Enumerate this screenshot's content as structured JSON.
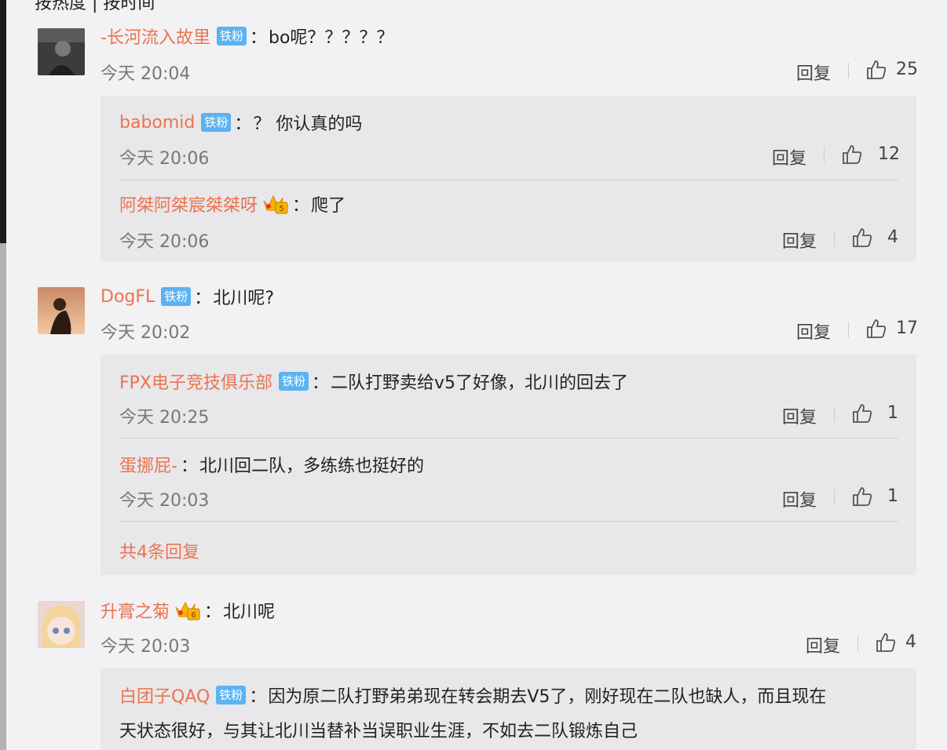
{
  "top_cut_text": "按热度 | 按时间",
  "comments": [
    {
      "user": "-长河流入故里",
      "badge": "铁粉",
      "text": "bo呢？？？？？",
      "time": "今天 20:04",
      "reply_label": "回复",
      "likes": "25",
      "replies": [
        {
          "user": "babomid",
          "badge": "铁粉",
          "text": "？ 你认真的吗",
          "time": "今天 20:06",
          "reply_label": "回复",
          "likes": "12"
        },
        {
          "user": "阿桀阿桀宸桀桀呀",
          "badge_icon": "crown-badge-icon",
          "text": "爬了",
          "time": "今天 20:06",
          "reply_label": "回复",
          "likes": "4"
        }
      ]
    },
    {
      "user": "DogFL",
      "badge": "铁粉",
      "text": "北川呢?",
      "time": "今天 20:02",
      "reply_label": "回复",
      "likes": "17",
      "replies": [
        {
          "user": "FPX电子竞技俱乐部",
          "badge": "铁粉",
          "text": "二队打野卖给v5了好像，北川的回去了",
          "time": "今天 20:25",
          "reply_label": "回复",
          "likes": "1"
        },
        {
          "user": "蛋挪屁-",
          "text": "北川回二队，多练练也挺好的",
          "time": "今天 20:03",
          "reply_label": "回复",
          "likes": "1"
        }
      ],
      "more_replies": "共4条回复"
    },
    {
      "user": "升膏之菊",
      "badge_icon": "crown-badge-icon",
      "text": "北川呢",
      "time": "今天 20:03",
      "reply_label": "回复",
      "likes": "4",
      "replies": [
        {
          "user": "白团子QAQ",
          "badge": "铁粉",
          "text_line1": "因为原二队打野弟弟现在转会期去V5了，刚好现在二队也缺人，而且现在",
          "text_line2": "天状态很好，与其让北川当替补当误职业生涯，不如去二队锻炼自己"
        }
      ]
    }
  ],
  "colors": {
    "username": "#eb7350",
    "badge": "#5ab3f2",
    "reply_bg": "#e8e7ea",
    "page_bg": "#f2f1f3"
  }
}
